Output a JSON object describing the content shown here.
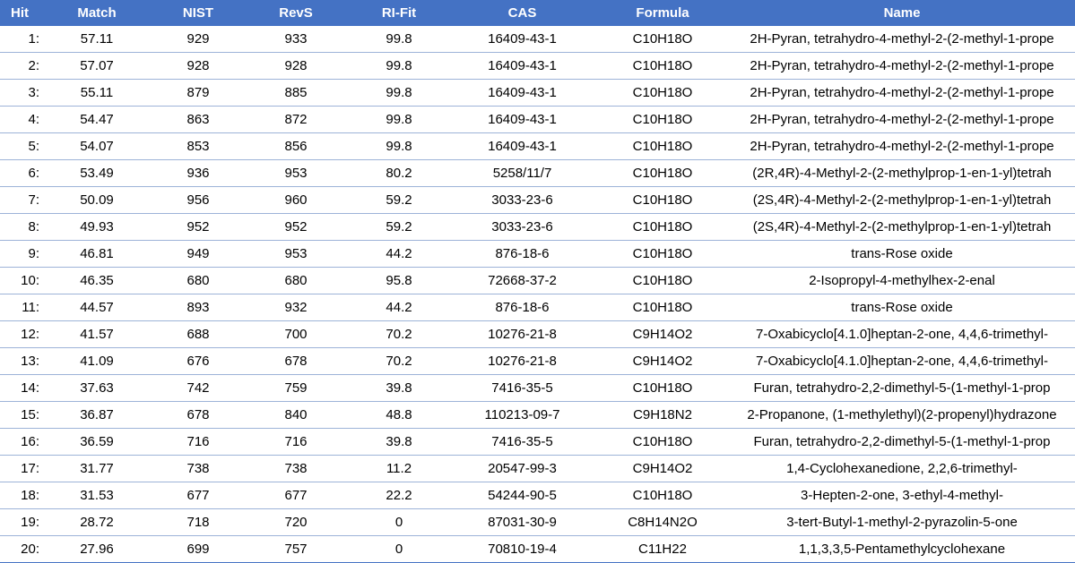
{
  "columns": [
    "Hit",
    "Match",
    "NIST",
    "RevS",
    "RI-Fit",
    "CAS",
    "Formula",
    "Name"
  ],
  "rows": [
    {
      "hit": "1:",
      "match": "57.11",
      "nist": "929",
      "revs": "933",
      "rifit": "99.8",
      "cas": "16409-43-1",
      "formula": "C10H18O",
      "name": "2H-Pyran, tetrahydro-4-methyl-2-(2-methyl-1-prope"
    },
    {
      "hit": "2:",
      "match": "57.07",
      "nist": "928",
      "revs": "928",
      "rifit": "99.8",
      "cas": "16409-43-1",
      "formula": "C10H18O",
      "name": "2H-Pyran, tetrahydro-4-methyl-2-(2-methyl-1-prope"
    },
    {
      "hit": "3:",
      "match": "55.11",
      "nist": "879",
      "revs": "885",
      "rifit": "99.8",
      "cas": "16409-43-1",
      "formula": "C10H18O",
      "name": "2H-Pyran, tetrahydro-4-methyl-2-(2-methyl-1-prope"
    },
    {
      "hit": "4:",
      "match": "54.47",
      "nist": "863",
      "revs": "872",
      "rifit": "99.8",
      "cas": "16409-43-1",
      "formula": "C10H18O",
      "name": "2H-Pyran, tetrahydro-4-methyl-2-(2-methyl-1-prope"
    },
    {
      "hit": "5:",
      "match": "54.07",
      "nist": "853",
      "revs": "856",
      "rifit": "99.8",
      "cas": "16409-43-1",
      "formula": "C10H18O",
      "name": "2H-Pyran, tetrahydro-4-methyl-2-(2-methyl-1-prope"
    },
    {
      "hit": "6:",
      "match": "53.49",
      "nist": "936",
      "revs": "953",
      "rifit": "80.2",
      "cas": "5258/11/7",
      "formula": "C10H18O",
      "name": "(2R,4R)-4-Methyl-2-(2-methylprop-1-en-1-yl)tetrah"
    },
    {
      "hit": "7:",
      "match": "50.09",
      "nist": "956",
      "revs": "960",
      "rifit": "59.2",
      "cas": "3033-23-6",
      "formula": "C10H18O",
      "name": "(2S,4R)-4-Methyl-2-(2-methylprop-1-en-1-yl)tetrah"
    },
    {
      "hit": "8:",
      "match": "49.93",
      "nist": "952",
      "revs": "952",
      "rifit": "59.2",
      "cas": "3033-23-6",
      "formula": "C10H18O",
      "name": "(2S,4R)-4-Methyl-2-(2-methylprop-1-en-1-yl)tetrah"
    },
    {
      "hit": "9:",
      "match": "46.81",
      "nist": "949",
      "revs": "953",
      "rifit": "44.2",
      "cas": "876-18-6",
      "formula": "C10H18O",
      "name": "trans-Rose oxide"
    },
    {
      "hit": "10:",
      "match": "46.35",
      "nist": "680",
      "revs": "680",
      "rifit": "95.8",
      "cas": "72668-37-2",
      "formula": "C10H18O",
      "name": "2-Isopropyl-4-methylhex-2-enal"
    },
    {
      "hit": "11:",
      "match": "44.57",
      "nist": "893",
      "revs": "932",
      "rifit": "44.2",
      "cas": "876-18-6",
      "formula": "C10H18O",
      "name": "trans-Rose oxide"
    },
    {
      "hit": "12:",
      "match": "41.57",
      "nist": "688",
      "revs": "700",
      "rifit": "70.2",
      "cas": "10276-21-8",
      "formula": "C9H14O2",
      "name": "7-Oxabicyclo[4.1.0]heptan-2-one, 4,4,6-trimethyl-"
    },
    {
      "hit": "13:",
      "match": "41.09",
      "nist": "676",
      "revs": "678",
      "rifit": "70.2",
      "cas": "10276-21-8",
      "formula": "C9H14O2",
      "name": "7-Oxabicyclo[4.1.0]heptan-2-one, 4,4,6-trimethyl-"
    },
    {
      "hit": "14:",
      "match": "37.63",
      "nist": "742",
      "revs": "759",
      "rifit": "39.8",
      "cas": "7416-35-5",
      "formula": "C10H18O",
      "name": "Furan, tetrahydro-2,2-dimethyl-5-(1-methyl-1-prop"
    },
    {
      "hit": "15:",
      "match": "36.87",
      "nist": "678",
      "revs": "840",
      "rifit": "48.8",
      "cas": "110213-09-7",
      "formula": "C9H18N2",
      "name": "2-Propanone, (1-methylethyl)(2-propenyl)hydrazone"
    },
    {
      "hit": "16:",
      "match": "36.59",
      "nist": "716",
      "revs": "716",
      "rifit": "39.8",
      "cas": "7416-35-5",
      "formula": "C10H18O",
      "name": "Furan, tetrahydro-2,2-dimethyl-5-(1-methyl-1-prop"
    },
    {
      "hit": "17:",
      "match": "31.77",
      "nist": "738",
      "revs": "738",
      "rifit": "11.2",
      "cas": "20547-99-3",
      "formula": "C9H14O2",
      "name": "1,4-Cyclohexanedione, 2,2,6-trimethyl-"
    },
    {
      "hit": "18:",
      "match": "31.53",
      "nist": "677",
      "revs": "677",
      "rifit": "22.2",
      "cas": "54244-90-5",
      "formula": "C10H18O",
      "name": "3-Hepten-2-one, 3-ethyl-4-methyl-"
    },
    {
      "hit": "19:",
      "match": "28.72",
      "nist": "718",
      "revs": "720",
      "rifit": "0",
      "cas": "87031-30-9",
      "formula": "C8H14N2O",
      "name": "3-tert-Butyl-1-methyl-2-pyrazolin-5-one"
    },
    {
      "hit": "20:",
      "match": "27.96",
      "nist": "699",
      "revs": "757",
      "rifit": "0",
      "cas": "70810-19-4",
      "formula": "C11H22",
      "name": "1,1,3,3,5-Pentamethylcyclohexane"
    }
  ],
  "colors": {
    "header_bg": "#4472c4",
    "header_text": "#ffffff",
    "row_border": "#9db3d8"
  }
}
